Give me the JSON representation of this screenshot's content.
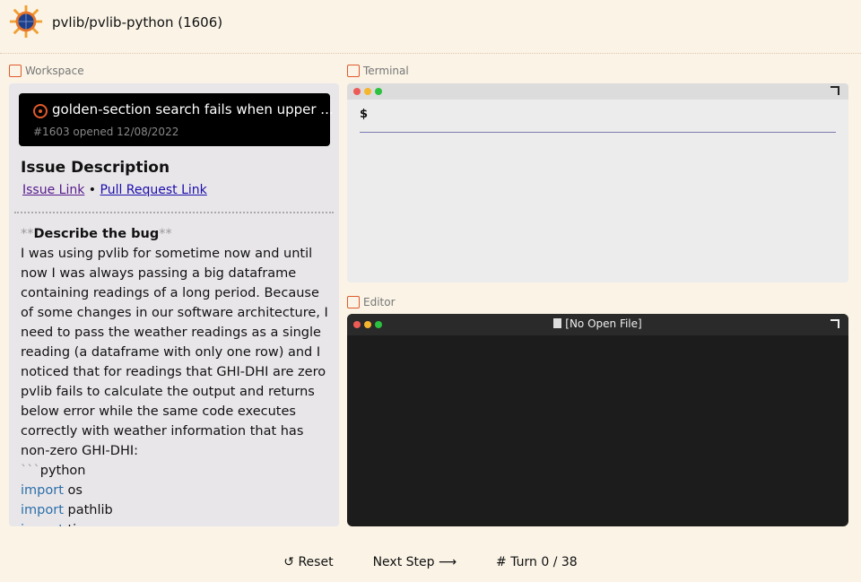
{
  "header": {
    "title": "pvlib/pvlib-python (1606)"
  },
  "workspace": {
    "label": "Workspace",
    "issue": {
      "title": "golden-section search fails when upper ...",
      "meta": "#1603 opened 12/08/2022"
    },
    "description_heading": "Issue Description",
    "links": {
      "issue": "Issue Link",
      "separator": "•",
      "pr": "Pull Request Link"
    },
    "body": {
      "md_open": "**",
      "heading": "Describe the bug",
      "md_close": "**",
      "paragraph": "I was using pvlib for sometime now and until now I was always passing a big dataframe containing readings of a long period. Because of some changes in our software architecture, I need to pass the weather readings as a single reading (a dataframe with only one row) and I noticed that for readings that GHI-DHI are zero pvlib fails to calculate the output and returns below error while the same code executes correctly with weather information that has non-zero GHI-DHI:",
      "fence_mark": "```",
      "fence_lang": "python",
      "code": [
        {
          "kw": "import",
          "rest": " os"
        },
        {
          "kw": "import",
          "rest": " pathlib"
        },
        {
          "kw": "import",
          "rest": " time"
        }
      ]
    }
  },
  "terminal": {
    "label": "Terminal",
    "prompt": "$"
  },
  "editor": {
    "label": "Editor",
    "title": "[No Open File]"
  },
  "controls": {
    "reset": "↺ Reset",
    "next": "Next Step ⟶",
    "turn": "# Turn 0 / 38"
  },
  "colors": {
    "accent": "#e05a2b",
    "dot_red": "#ee5b55",
    "dot_yellow": "#f5b62e",
    "dot_green": "#2cc13f"
  }
}
